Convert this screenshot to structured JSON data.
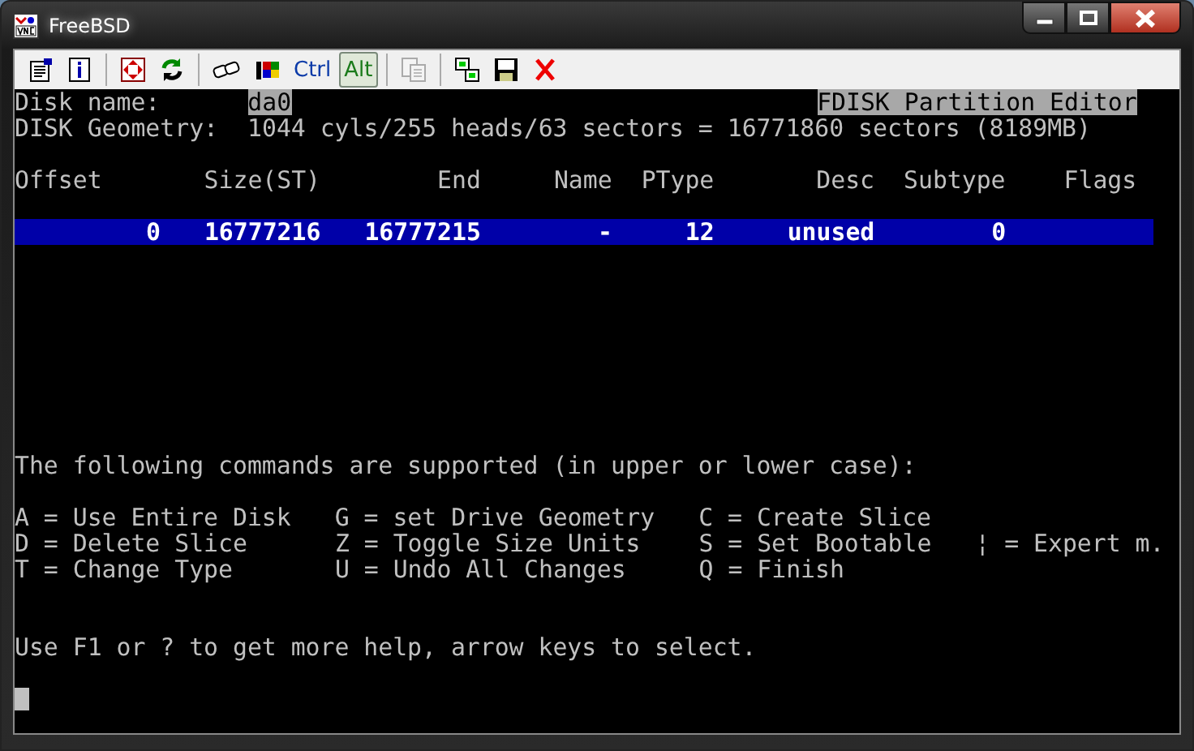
{
  "window": {
    "title": "FreeBSD"
  },
  "toolbar": {
    "ctrl": {
      "label": "Ctrl",
      "pressed": false
    },
    "alt": {
      "label": "Alt",
      "pressed": true
    },
    "copy_disabled": true
  },
  "terminal": {
    "disk_name_label": "Disk name:",
    "disk_name": "da0",
    "editor_title": "FDISK Partition Editor",
    "geometry_label": "DISK Geometry:",
    "geometry": "1044 cyls/255 heads/63 sectors = 16771860 sectors (8189MB)",
    "columns": [
      "Offset",
      "Size(ST)",
      "End",
      "Name",
      "PType",
      "Desc",
      "Subtype",
      "Flags"
    ],
    "rows": [
      {
        "cells": [
          "0",
          "16777216",
          "16777215",
          "-",
          "12",
          "unused",
          "0"
        ],
        "selected": true
      }
    ],
    "commands_intro": "The following commands are supported (in upper or lower case):",
    "commands": [
      [
        "A = Use Entire Disk",
        "G = set Drive Geometry",
        "C = Create Slice"
      ],
      [
        "D = Delete Slice",
        "Z = Toggle Size Units",
        "S = Set Bootable",
        "¦ = Expert m."
      ],
      [
        "T = Change Type",
        "U = Undo All Changes",
        "Q = Finish"
      ]
    ],
    "help": "Use F1 or ? to get more help, arrow keys to select.",
    "cursor": true
  }
}
